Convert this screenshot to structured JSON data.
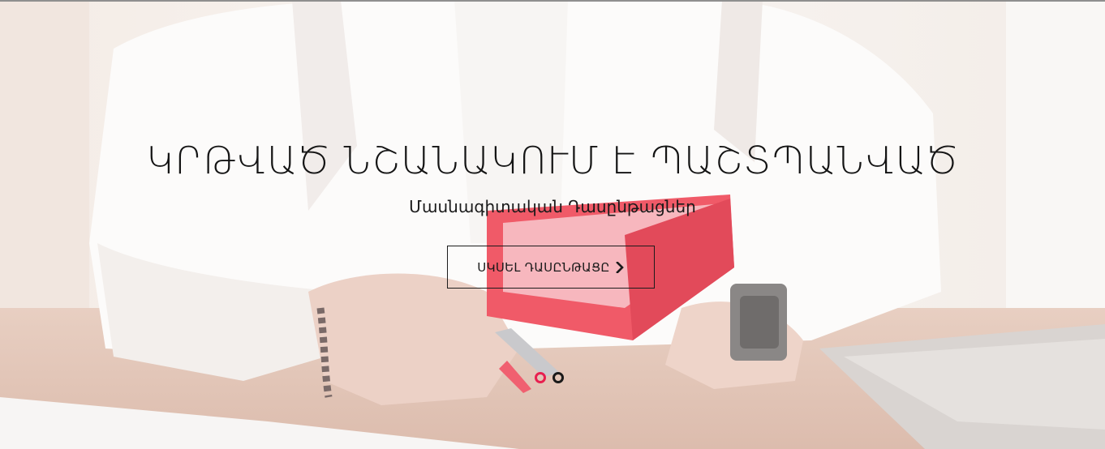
{
  "hero": {
    "title": "ԿՐԹՎԱԾ ՆՇԱՆԱԿՈՒՄ Է ՊԱՇՏՊԱՆՎԱԾ",
    "subtitle": "Մասնագիտական Դասընթացներ",
    "cta_label": "ՍԿՍԵԼ ԴԱՍԸՆԹԱՑԸ",
    "cta_icon": "chevron-right-icon",
    "background_image": "man-with-red-notebook"
  },
  "slider": {
    "slide_count": 2,
    "active_index": 0
  },
  "colors": {
    "accent": "#e8204f",
    "text": "#141414",
    "notebook": "#f04a5a"
  }
}
